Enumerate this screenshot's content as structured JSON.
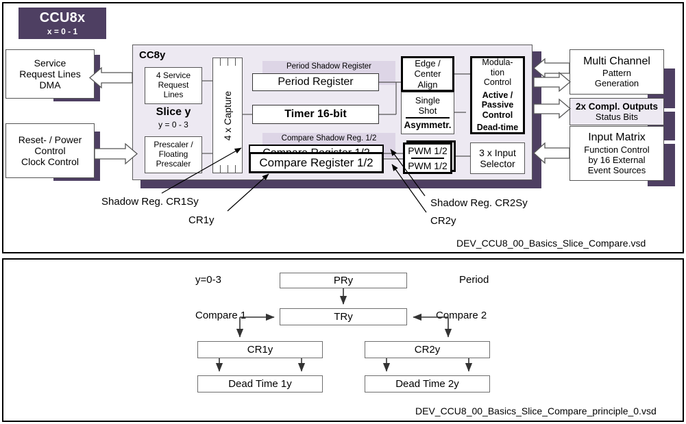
{
  "title_chip": {
    "name": "CCU8x",
    "variant": "x = 0 - 1"
  },
  "left_blocks": [
    {
      "id": "service-request",
      "lines": [
        "Service",
        "Request Lines",
        "DMA"
      ]
    },
    {
      "id": "reset-power",
      "lines": [
        "Reset- / Power",
        "Control",
        "Clock Control"
      ]
    }
  ],
  "cc8y": {
    "label": "CC8y",
    "service_box": [
      "4 Service",
      "Request",
      "Lines"
    ],
    "slice_label": "Slice y",
    "slice_sub": "y = 0 - 3",
    "prescaler_box": [
      "Prescaler /",
      "Floating",
      "Prescaler"
    ],
    "capture_label": "4 x Capture",
    "period_shadow": "Period Shadow Register",
    "period_register": "Period Register",
    "timer": "Timer 16-bit",
    "compare_shadow": "Compare Shadow Reg. 1/2",
    "compare_register_under": "Compare Register 1/2",
    "compare_register_callout": "Compare Register 1/2",
    "edge_center": [
      "Edge /",
      "Center",
      "Align"
    ],
    "single_shot": [
      "Single",
      "Shot"
    ],
    "asymmetr": "Asymmetr.",
    "pwm_top": "PWM 1/2",
    "pwm_bottom": "PWM 1/2",
    "modulation": [
      "Modula-",
      "tion",
      "Control"
    ],
    "active_passive": [
      "Active /",
      "Passive",
      "Control"
    ],
    "dead_time": "Dead-time",
    "input_selector": [
      "3 x Input",
      "Selector"
    ]
  },
  "right_blocks": [
    {
      "id": "multi-channel",
      "title": "Multi Channel",
      "lines": [
        "Pattern",
        "Generation"
      ]
    },
    {
      "id": "compl-outputs",
      "title": "2x Compl. Outputs",
      "lines": [
        "Status Bits"
      ]
    },
    {
      "id": "input-matrix",
      "title": "Input Matrix",
      "lines": [
        "Function Control",
        "by 16 External",
        "Event Sources"
      ]
    }
  ],
  "annotations": [
    {
      "id": "shadow-reg-cr1sy",
      "text": "Shadow Reg. CR1Sy"
    },
    {
      "id": "cr1y",
      "text": "CR1y"
    },
    {
      "id": "shadow-reg-cr2sy",
      "text": "Shadow Reg. CR2Sy"
    },
    {
      "id": "cr2y",
      "text": "CR2y"
    }
  ],
  "file_captions": {
    "top": "DEV_CCU8_00_Basics_Slice_Compare.vsd",
    "bottom": "DEV_CCU8_00_Basics_Slice_Compare_principle_0.vsd"
  },
  "bottom_diagram": {
    "y_range": "y=0-3",
    "period_label": "Period",
    "compare1_label": "Compare 1",
    "compare2_label": "Compare 2",
    "boxes": {
      "pry": "PRy",
      "try": "TRy",
      "cr1y": "CR1y",
      "cr2y": "CR2y",
      "deadtime1": "Dead Time 1y",
      "deadtime2": "Dead Time 2y"
    }
  },
  "colors": {
    "purple": "#4E3F62",
    "lavender_panel": "#EDE9F2",
    "lavender_strip": "#DDD5E6",
    "border": "#6b6b6b"
  }
}
